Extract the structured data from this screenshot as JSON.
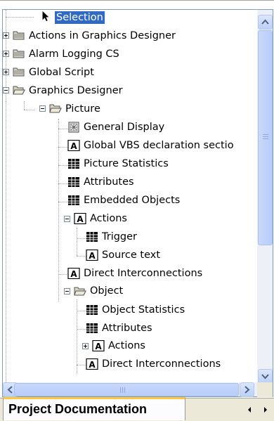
{
  "tree": {
    "items": [
      {
        "label": "Selection",
        "icon": "cursor-arrow-icon",
        "expander": "none",
        "selected": true
      },
      {
        "label": "Actions in Graphics Designer",
        "icon": "folder-icon",
        "expander": "plus"
      },
      {
        "label": "Alarm Logging CS",
        "icon": "folder-icon",
        "expander": "plus"
      },
      {
        "label": "Global Script",
        "icon": "folder-icon",
        "expander": "plus"
      },
      {
        "label": "Graphics Designer",
        "icon": "open-folder-icon",
        "expander": "minus"
      },
      {
        "label": "Picture",
        "icon": "open-folder-icon",
        "expander": "minus"
      },
      {
        "label": "General Display",
        "icon": "general-display-icon",
        "expander": "none"
      },
      {
        "label": "Global VBS declaration sectio",
        "icon": "text-a-icon",
        "expander": "none"
      },
      {
        "label": "Picture Statistics",
        "icon": "table-icon",
        "expander": "none"
      },
      {
        "label": "Attributes",
        "icon": "table-icon",
        "expander": "none"
      },
      {
        "label": "Embedded Objects",
        "icon": "table-icon",
        "expander": "none"
      },
      {
        "label": "Actions",
        "icon": "text-a-icon",
        "expander": "minus"
      },
      {
        "label": "Trigger",
        "icon": "table-icon",
        "expander": "none"
      },
      {
        "label": "Source text",
        "icon": "text-a-icon",
        "expander": "none"
      },
      {
        "label": "Direct Interconnections",
        "icon": "text-a-icon",
        "expander": "none"
      },
      {
        "label": "Object",
        "icon": "open-folder-icon",
        "expander": "minus"
      },
      {
        "label": "Object Statistics",
        "icon": "table-icon",
        "expander": "none"
      },
      {
        "label": "Attributes",
        "icon": "table-icon",
        "expander": "none"
      },
      {
        "label": "Actions",
        "icon": "text-a-icon",
        "expander": "plus"
      },
      {
        "label": "Direct Interconnections",
        "icon": "text-a-icon",
        "expander": "none"
      }
    ]
  },
  "scrollbars": {
    "vertical": {
      "up_icon": "arrow-up-icon",
      "down_icon": "arrow-down-icon"
    },
    "horizontal": {
      "left_icon": "arrow-left-icon",
      "right_icon": "arrow-right-icon"
    }
  },
  "tabs": {
    "active_label": "Project Documentation",
    "prev_icon": "tab-prev-icon",
    "next_icon": "tab-next-icon"
  },
  "colors": {
    "selection": "#316ac5",
    "tab_accent": "#ffc83c",
    "scrollbar": "#bcd0f7"
  }
}
